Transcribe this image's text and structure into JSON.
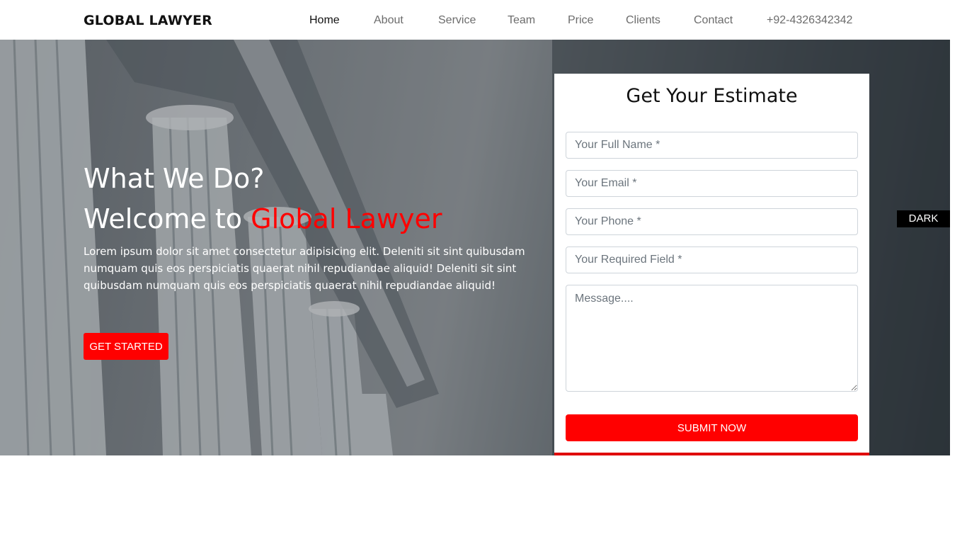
{
  "navbar": {
    "brand": "GLOBAL LAWYER",
    "links": [
      "Home",
      "About",
      "Service",
      "Team",
      "Price",
      "Clients",
      "Contact"
    ],
    "phone": "+92-4326342342",
    "active": "Home"
  },
  "hero": {
    "title_line1": "What We Do?",
    "title_prefix": "Welcome to",
    "title_accent": "Global Lawyer",
    "description": "Lorem ipsum dolor sit amet consectetur adipisicing elit. Deleniti sit sint quibusdam numquam quis eos perspiciatis quaerat nihil repudiandae aliquid! Deleniti sit sint quibusdam numquam quis eos perspiciatis quaerat nihil repudiandae aliquid!",
    "cta_label": "GET STARTED"
  },
  "form": {
    "title": "Get Your Estimate",
    "name_placeholder": "Your Full Name *",
    "email_placeholder": "Your Email *",
    "phone_placeholder": "Your Phone *",
    "required_placeholder": "Your Required Field *",
    "message_placeholder": "Message....",
    "submit_label": "SUBMIT NOW"
  },
  "theme_toggle": "DARK",
  "colors": {
    "accent": "#ff0000",
    "nav_text": "#6c6c6c",
    "toggle_bg": "#000000"
  }
}
